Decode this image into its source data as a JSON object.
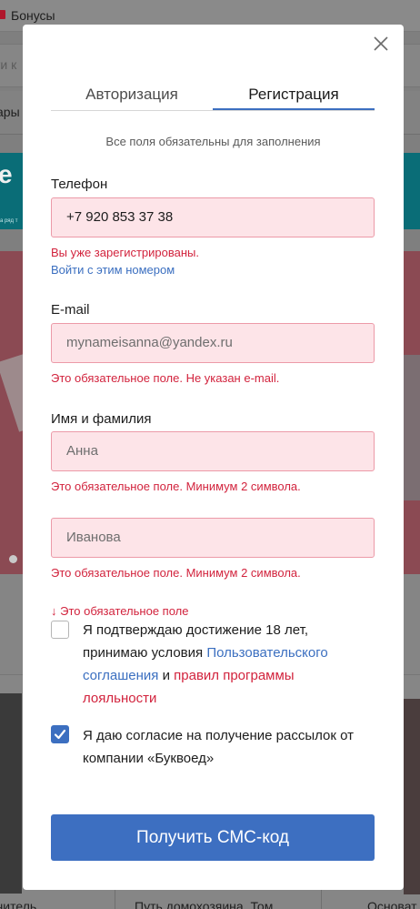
{
  "background": {
    "bonus_label": "Бонусы",
    "search_fragment": "ти к",
    "goods_fragment": "ары",
    "product_titles": [
      "читель",
      "Путь домохозяина. Том",
      "Основат"
    ]
  },
  "modal": {
    "tabs": [
      {
        "label": "Авторизация",
        "active": false
      },
      {
        "label": "Регистрация",
        "active": true
      }
    ],
    "subtitle": "Все поля обязательны для заполнения",
    "phone": {
      "label": "Телефон",
      "value": "+7 920 853 37 38",
      "error": "Вы уже зарегистрированы.",
      "link": "Войти с этим номером"
    },
    "email": {
      "label": "E-mail",
      "value": "mynameisanna@yandex.ru",
      "error": "Это обязательное поле. Не указан e-mail."
    },
    "name": {
      "label": "Имя и фамилия",
      "first_value": "Анна",
      "first_error": "Это обязательное поле. Минимум 2 символа.",
      "last_value": "Иванова",
      "last_error": "Это обязательное поле. Минимум 2 символа."
    },
    "age_consent": {
      "error": "↓ Это обязательное поле",
      "checked": false,
      "text_before": "Я подтверждаю достижение 18 лет, принимаю условия ",
      "link_user_agreement": "Пользовательского соглашения",
      "text_middle": " и ",
      "link_loyalty": "правил программы лояльности"
    },
    "newsletter_consent": {
      "checked": true,
      "text": "Я даю согласие на получение рассылок от компании «Буквоед»"
    },
    "submit_label": "Получить СМС-код"
  },
  "colors": {
    "accent": "#3c6fc0",
    "error": "#d2233d",
    "field_error_bg": "#fde4e8",
    "field_error_border": "#ec9aa8"
  }
}
